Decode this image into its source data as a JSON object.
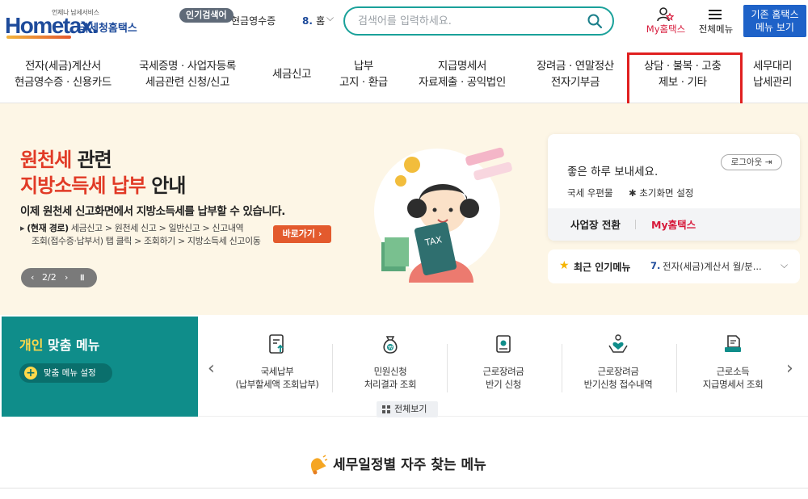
{
  "header": {
    "logo_small": "언제나 납세서비스",
    "logo_main": "Hometax.",
    "logo_kr": "국세청홈택스",
    "popular_badge": "인기검색어",
    "popular_item": "현금영수증",
    "popular_rank": "8.",
    "popular_rank_tail": "홈",
    "search_placeholder": "검색어를 입력하세요.",
    "my_hometax": "My홈택스",
    "all_menu": "전체메뉴",
    "old_menu_line1": "기존 홈택스",
    "old_menu_line2": "메뉴 보기"
  },
  "gnb": [
    {
      "l1": "전자(세금)계산서",
      "l2": "현금영수증 · 신용카드"
    },
    {
      "l1": "국세증명 · 사업자등록",
      "l2": "세금관련 신청/신고"
    },
    {
      "l1": "세금신고",
      "l2": ""
    },
    {
      "l1": "납부",
      "l2": "고지 · 환급"
    },
    {
      "l1": "지급명세서",
      "l2": "자료제출 · 공익법인"
    },
    {
      "l1": "장려금 · 연말정산",
      "l2": "전자기부금"
    },
    {
      "l1": "상담 · 불복 · 고충",
      "l2": "제보 · 기타"
    },
    {
      "l1": "세무대리",
      "l2": "납세관리"
    }
  ],
  "banner": {
    "title1_red": "원천세",
    "title1_black": " 관련",
    "title2_red": "지방소득세 납부",
    "title2_black": " 안내",
    "desc": "이제 원천세 신고화면에서 지방소득세를 납부할 수 있습니다.",
    "path_label": "(현재 경로)",
    "path_line1": " 세금신고 > 원천세 신고 > 일반신고 > 신고내역",
    "path_line2": "조회(접수증·납부서) 탭 클릭 > 조회하기 > 지방소득세 신고이동",
    "go_button": "바로가기",
    "pager": "2/2",
    "tax_label": "TAX"
  },
  "login_card": {
    "greeting": "좋은 하루 보내세요.",
    "logout": "로그아웃",
    "post": "국세 우편물",
    "init": "초기화면 설정",
    "biz_switch": "사업장 전환",
    "my_hometax": "My홈택스"
  },
  "recent": {
    "label": "최근 인기메뉴",
    "num": "7.",
    "text": "전자(세금)계산서 월/분..."
  },
  "custom_menu": {
    "title_y": "개인",
    "title_w": " 맞춤 메뉴",
    "setting": "맞춤 메뉴 설정",
    "all_view": "전체보기",
    "items": [
      {
        "l1": "국세납부",
        "l2": "(납부할세액 조회납부)"
      },
      {
        "l1": "민원신청",
        "l2": "처리결과 조회"
      },
      {
        "l1": "근로장려금",
        "l2": "반기 신청"
      },
      {
        "l1": "근로장려금",
        "l2": "반기신청 접수내역"
      },
      {
        "l1": "근로소득",
        "l2": "지급명세서 조회"
      }
    ]
  },
  "schedule": {
    "title": "세무일정별 자주 찾는 메뉴"
  },
  "colors": {
    "brand_blue": "#1e4b9b",
    "teal": "#0f8d8a",
    "accent_red": "#e13a26",
    "highlight_box": "#e02020"
  }
}
